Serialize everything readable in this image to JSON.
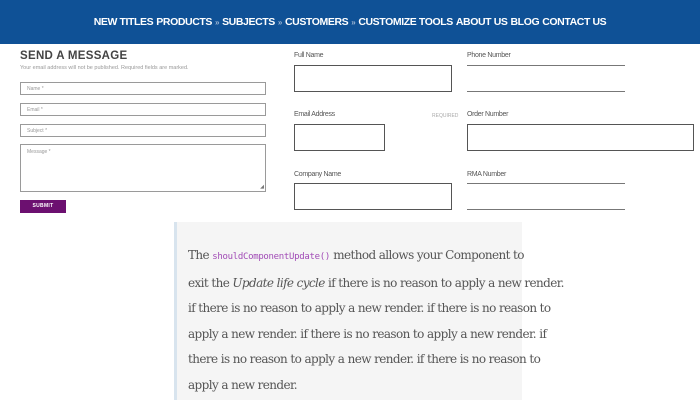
{
  "nav": {
    "items": [
      "NEW TITLES",
      "PRODUCTS",
      "SUBJECTS",
      "CUSTOMERS",
      "CUSTOMIZE TOOLS",
      "ABOUT US",
      "BLOG",
      "CONTACT US"
    ],
    "separator": "»"
  },
  "contact_form": {
    "title": "SEND A MESSAGE",
    "note": "Your email address will not be published. Required fields are marked.",
    "name_placeholder": "Name *",
    "email_placeholder": "Email *",
    "subject_placeholder": "Subject *",
    "message_placeholder": "Message *",
    "submit_label": "SUBMIT"
  },
  "order_form": {
    "full_name_label": "Full Name",
    "phone_label": "Phone Number",
    "email_label": "Email Address",
    "required_label": "REQUIRED",
    "order_label": "Order Number",
    "company_label": "Company Name",
    "rma_label": "RMA Number"
  },
  "note": {
    "lines": [
      {
        "pre": "The ",
        "code": "shouldComponentUpdate()",
        "post": " method allows your Component to"
      },
      {
        "pre": "exit the ",
        "em": "Update life cycle",
        "post": " if there is no reason to apply a new render."
      },
      {
        "text": "if there is no reason to apply a new render. if there is no reason to"
      },
      {
        "text": "apply a new render. if there is no reason to apply a new render. if"
      },
      {
        "text": "there is no reason to apply a new render. if there is no reason to"
      },
      {
        "text": "apply a new render."
      }
    ]
  },
  "colors": {
    "nav_bg": "#0f5196",
    "submit_bg": "#6c1070",
    "code_text": "#a14bb6"
  }
}
